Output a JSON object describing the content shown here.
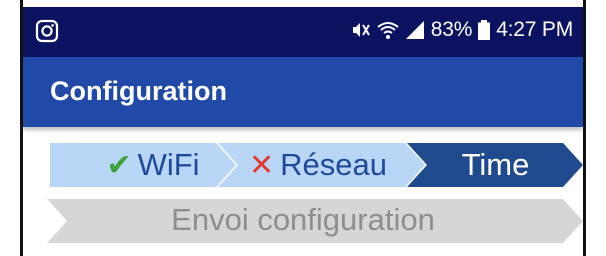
{
  "status_bar": {
    "left_icon": "instagram-icon",
    "icons": [
      "mute-icon",
      "wifi-icon",
      "signal-icon"
    ],
    "battery": "83%",
    "battery_icon": "battery-icon",
    "time": "4:27 PM"
  },
  "app_bar": {
    "title": "Configuration"
  },
  "steps": [
    {
      "label": "WiFi",
      "state": "done",
      "icon": "check-icon"
    },
    {
      "label": "Réseau",
      "state": "error",
      "icon": "cross-icon"
    },
    {
      "label": "Time",
      "state": "active"
    },
    {
      "label": "Envoi configuration",
      "state": "pending"
    }
  ],
  "colors": {
    "status_bar": "#0b1260",
    "app_bar": "#2149a8",
    "step_done": "#b9d6f6",
    "step_active": "#1f4a8e",
    "step_pending": "#d6d6d6",
    "check": "#3ba43c",
    "cross": "#e03a2c"
  }
}
